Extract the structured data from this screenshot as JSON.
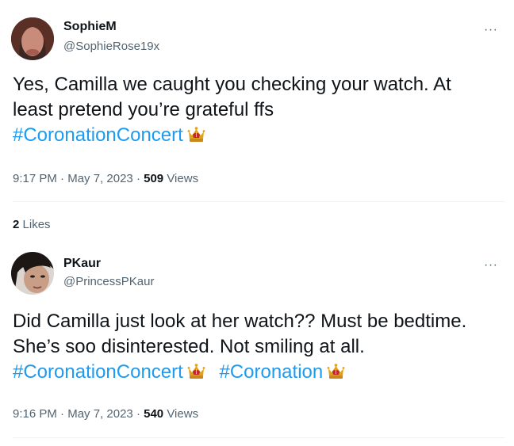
{
  "tweets": [
    {
      "name": "SophieM",
      "handle": "@SophieRose19x",
      "text_line1": "Yes, Camilla we caught you checking your watch. At",
      "text_line2": "least pretend you’re grateful ffs",
      "hashtags": [
        "#CoronationConcert"
      ],
      "time": "9:17 PM",
      "date": "May 7, 2023",
      "views_count": "509",
      "views_label": "Views",
      "likes_count": "2",
      "likes_label": "Likes"
    },
    {
      "name": "PKaur",
      "handle": "@PrincessPKaur",
      "text_line1": "Did Camilla just look at her watch?? Must be bedtime.",
      "text_line2": "She’s soo disinterested. Not smiling at all.",
      "hashtags": [
        "#CoronationConcert",
        "#Coronation"
      ],
      "time": "9:16 PM",
      "date": "May 7, 2023",
      "views_count": "540",
      "views_label": "Views"
    }
  ],
  "separator": "·",
  "more_glyph": "···",
  "colors": {
    "hashtag": "#1d9bf0",
    "secondary_text": "#536471",
    "primary_text": "#0f1419",
    "divider": "#eff3f4"
  },
  "icons": {
    "crown": "crown-emoji-icon",
    "more": "more-options-icon"
  }
}
